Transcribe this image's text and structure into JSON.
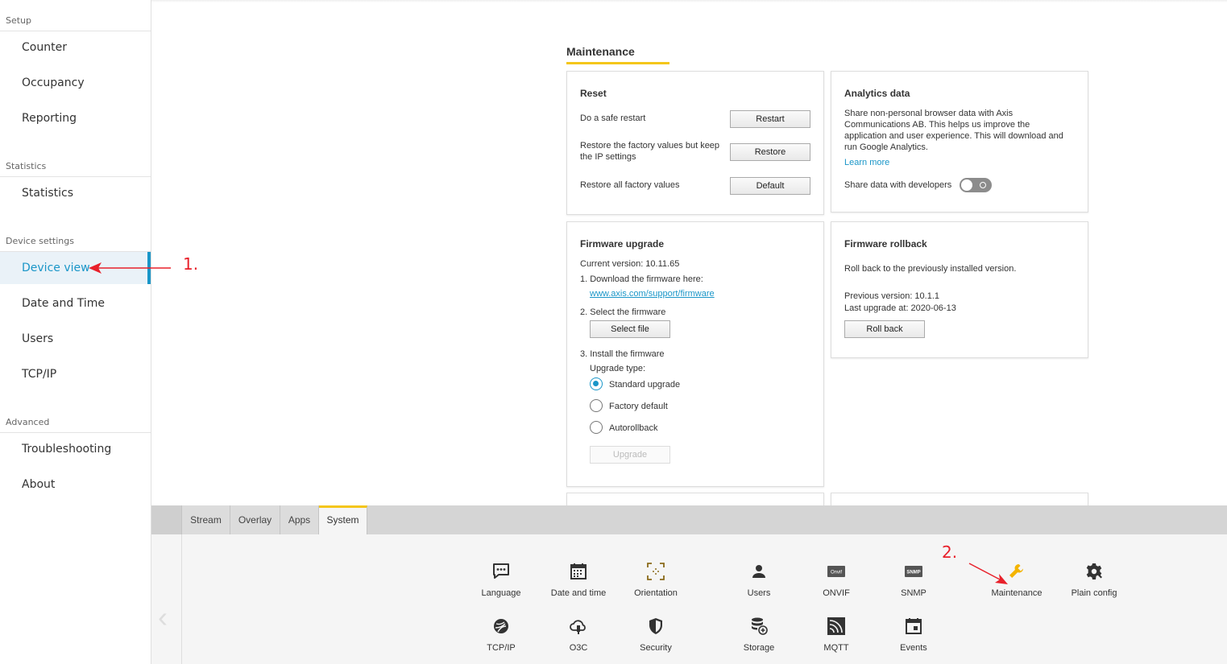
{
  "sidebar": {
    "sections": [
      {
        "heading": "Setup",
        "items": [
          "Counter",
          "Occupancy",
          "Reporting"
        ]
      },
      {
        "heading": "Statistics",
        "items": [
          "Statistics"
        ]
      },
      {
        "heading": "Device settings",
        "items": [
          "Device view",
          "Date and Time",
          "Users",
          "TCP/IP"
        ]
      },
      {
        "heading": "Advanced",
        "items": [
          "Troubleshooting",
          "About"
        ]
      }
    ],
    "active_item": "Device view"
  },
  "main": {
    "title": "Maintenance",
    "reset": {
      "title": "Reset",
      "rows": [
        {
          "text": "Do a safe restart",
          "button": "Restart"
        },
        {
          "text": "Restore the factory values but keep the IP settings",
          "button": "Restore"
        },
        {
          "text": "Restore all factory values",
          "button": "Default"
        }
      ]
    },
    "analytics": {
      "title": "Analytics data",
      "description": "Share non-personal browser data with Axis Communications AB. This helps us improve the application and user experience. This will download and run Google Analytics.",
      "learn_more": "Learn more",
      "share_label": "Share data with developers",
      "share_enabled": false
    },
    "firmware_upgrade": {
      "title": "Firmware upgrade",
      "current_version": "Current version: 10.11.65",
      "step1": "1. Download the firmware here:",
      "link": "www.axis.com/support/firmware",
      "step2": "2. Select the firmware",
      "select_file": "Select file",
      "step3": "3. Install the firmware",
      "upgrade_type_label": "Upgrade type:",
      "options": [
        "Standard upgrade",
        "Factory default",
        "Autorollback"
      ],
      "selected_option": "Standard upgrade",
      "upgrade_button": "Upgrade"
    },
    "firmware_rollback": {
      "title": "Firmware rollback",
      "description": "Roll back to the previously installed version.",
      "previous_version": "Previous version: 10.1.1",
      "last_upgrade": "Last upgrade at: 2020-06-13",
      "button": "Roll back"
    }
  },
  "bottom": {
    "tabs": [
      "Stream",
      "Overlay",
      "Apps",
      "System"
    ],
    "active_tab": "System",
    "tools_row1": [
      {
        "label": "Language",
        "icon": "language-icon"
      },
      {
        "label": "Date and time",
        "icon": "calendar-icon"
      },
      {
        "label": "Orientation",
        "icon": "orientation-icon"
      },
      {
        "label": "Users",
        "icon": "user-icon"
      },
      {
        "label": "ONVIF",
        "icon": "onvif-icon"
      },
      {
        "label": "SNMP",
        "icon": "snmp-icon"
      },
      {
        "label": "Maintenance",
        "icon": "wrench-icon"
      },
      {
        "label": "Plain config",
        "icon": "gear-icon"
      }
    ],
    "tools_row2": [
      {
        "label": "TCP/IP",
        "icon": "network-icon"
      },
      {
        "label": "O3C",
        "icon": "cloud-icon"
      },
      {
        "label": "Security",
        "icon": "shield-icon"
      },
      {
        "label": "Storage",
        "icon": "storage-icon"
      },
      {
        "label": "MQTT",
        "icon": "mqtt-icon"
      },
      {
        "label": "Events",
        "icon": "events-icon"
      }
    ],
    "onvif_badge": "Onvif",
    "snmp_badge": "SNMP"
  },
  "annotations": {
    "step1": "1.",
    "step2": "2."
  },
  "colors": {
    "accent": "#1a96c8",
    "highlight": "#f4c61a",
    "annotation": "#e8202a"
  }
}
